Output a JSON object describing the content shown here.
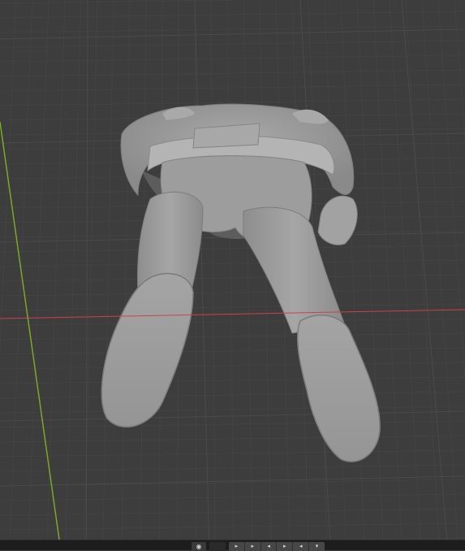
{
  "viewport": {
    "background": "#3d3d3d",
    "grid_color": "#4a4a4a",
    "x_axis_color": "#c9424f",
    "y_axis_color": "#7da823",
    "model_color": "#9b9b9b",
    "object": "figure-model-bottom-view"
  },
  "toolbar": {
    "background": "#1d1d1d",
    "left_button_icon": "camera-icon",
    "toggle_icon": "overlay-toggle-icon",
    "tool_icons": [
      "arrow-icon",
      "arrow-icon",
      "move-icon",
      "rotate-icon",
      "scale-icon",
      "transform-icon"
    ],
    "tool_glyphs": [
      "▸",
      "▸",
      "◂",
      "▸",
      "◂",
      "▾"
    ]
  }
}
